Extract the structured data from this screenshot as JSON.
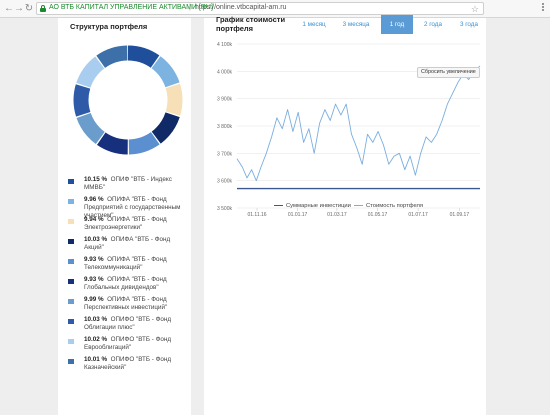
{
  "browser": {
    "site_name": "АО ВТБ КАПИТАЛ УПРАВЛЕНИЕ АКТИВАМИ [RU]",
    "separator": "|",
    "url": "https://online.vtbcapital-am.ru"
  },
  "portfolio": {
    "title": "Структура портфеля",
    "items": [
      {
        "percent": "10.15 %",
        "name": "ОПИФ \"ВТБ - Индекс ММВБ\"",
        "color": "#1f4e9a",
        "value": 10.15
      },
      {
        "percent": "9.96 %",
        "name": "ОПИФА \"ВТБ - Фонд Предприятий с государственным участием\"",
        "color": "#7db3e0",
        "value": 9.96
      },
      {
        "percent": "9.94 %",
        "name": "ОПИФА \"ВТБ - Фонд Электроэнергетики\"",
        "color": "#f7dfb8",
        "value": 9.94
      },
      {
        "percent": "10.03 %",
        "name": "ОПИФА \"ВТБ - Фонд Акций\"",
        "color": "#0f2a66",
        "value": 10.03
      },
      {
        "percent": "9.93 %",
        "name": "ОПИФА \"ВТБ - Фонд Телекоммуникаций\"",
        "color": "#5b8fd0",
        "value": 9.93
      },
      {
        "percent": "9.93 %",
        "name": "ОПИФА \"ВТБ - Фонд Глобальных дивидендов\"",
        "color": "#17307e",
        "value": 9.93
      },
      {
        "percent": "9.99 %",
        "name": "ОПИФА \"ВТБ - Фонд Перспективных инвестиций\"",
        "color": "#6a9ccc",
        "value": 9.99
      },
      {
        "percent": "10.03 %",
        "name": "ОПИФО \"ВТБ - Фонд Облигации плюс\"",
        "color": "#2f5aa8",
        "value": 10.03
      },
      {
        "percent": "10.02 %",
        "name": "ОПИФО \"ВТБ - Фонд Еврооблигаций\"",
        "color": "#a9cdef",
        "value": 10.02
      },
      {
        "percent": "10.01 %",
        "name": "ОПИФО \"ВТБ - Фонд Казначейский\"",
        "color": "#3d6fa9",
        "value": 10.01
      }
    ]
  },
  "value_chart": {
    "title": "График стоимости портфеля",
    "tabs": [
      {
        "label": "1 месяц",
        "active": false
      },
      {
        "label": "3 месяца",
        "active": false
      },
      {
        "label": "1 год",
        "active": true
      },
      {
        "label": "2 года",
        "active": false
      },
      {
        "label": "3 года",
        "active": false
      }
    ],
    "reset_zoom": "Сбросить увеличение",
    "legend": {
      "investments": "Суммарные инвестиции",
      "value": "Стоимость портфеля"
    },
    "colors": {
      "value": "#7aaee0",
      "investments": "#3a5790",
      "active_tab": "#5b9bd5"
    }
  },
  "chart_data": {
    "type": "line",
    "y_ticks": [
      "3 500k",
      "3 600k",
      "3 700k",
      "3 800k",
      "3 900k",
      "4 000k",
      "4 100k"
    ],
    "x_ticks": [
      "01.11.16",
      "01.01.17",
      "01.03.17",
      "01.05.17",
      "01.07.17",
      "01.09.17"
    ],
    "ylim": [
      3500,
      4100
    ],
    "series": [
      {
        "name": "Суммарные инвестиции",
        "values": [
          [
            0,
            3571
          ],
          [
            365,
            3571
          ]
        ]
      },
      {
        "name": "Стоимость портфеля",
        "values": [
          [
            0,
            3680
          ],
          [
            8,
            3650
          ],
          [
            15,
            3610
          ],
          [
            22,
            3640
          ],
          [
            29,
            3600
          ],
          [
            36,
            3650
          ],
          [
            44,
            3700
          ],
          [
            52,
            3760
          ],
          [
            60,
            3830
          ],
          [
            68,
            3790
          ],
          [
            76,
            3860
          ],
          [
            84,
            3780
          ],
          [
            92,
            3850
          ],
          [
            100,
            3740
          ],
          [
            108,
            3790
          ],
          [
            116,
            3700
          ],
          [
            124,
            3810
          ],
          [
            132,
            3860
          ],
          [
            140,
            3820
          ],
          [
            148,
            3880
          ],
          [
            156,
            3840
          ],
          [
            164,
            3880
          ],
          [
            172,
            3770
          ],
          [
            180,
            3720
          ],
          [
            188,
            3660
          ],
          [
            196,
            3770
          ],
          [
            204,
            3740
          ],
          [
            212,
            3780
          ],
          [
            220,
            3730
          ],
          [
            228,
            3660
          ],
          [
            236,
            3690
          ],
          [
            244,
            3700
          ],
          [
            252,
            3640
          ],
          [
            260,
            3690
          ],
          [
            268,
            3620
          ],
          [
            276,
            3700
          ],
          [
            284,
            3760
          ],
          [
            292,
            3740
          ],
          [
            300,
            3770
          ],
          [
            308,
            3820
          ],
          [
            316,
            3880
          ],
          [
            324,
            3920
          ],
          [
            332,
            3960
          ],
          [
            340,
            3990
          ],
          [
            348,
            3970
          ],
          [
            356,
            4000
          ],
          [
            365,
            4020
          ]
        ]
      }
    ]
  }
}
